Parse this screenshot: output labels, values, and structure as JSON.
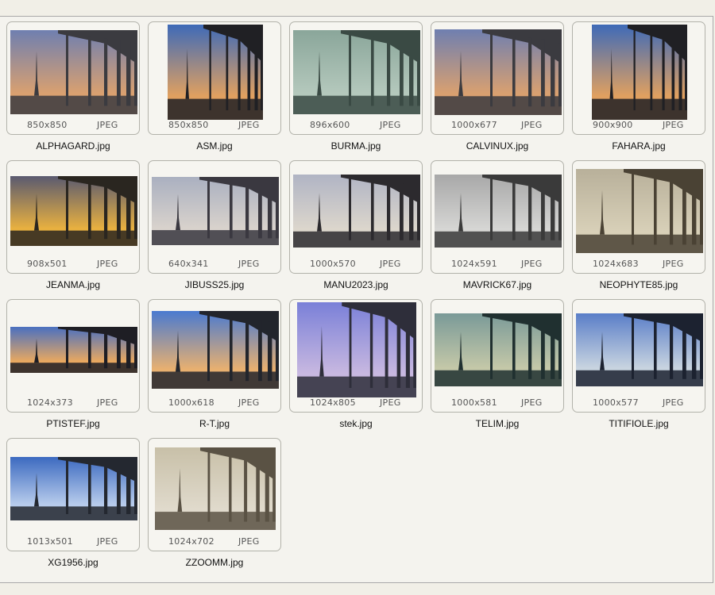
{
  "files": [
    {
      "name": "ALPHAGARD.jpg",
      "dims": "850x850",
      "type": "JPEG",
      "tone": "dusk"
    },
    {
      "name": "ASM.jpg",
      "dims": "850x850",
      "type": "JPEG",
      "tone": "blue-black"
    },
    {
      "name": "BURMA.jpg",
      "dims": "896x600",
      "type": "JPEG",
      "tone": "green"
    },
    {
      "name": "CALVINUX.jpg",
      "dims": "1000x677",
      "type": "JPEG",
      "tone": "dusk"
    },
    {
      "name": "FAHARA.jpg",
      "dims": "900x900",
      "type": "JPEG",
      "tone": "blue-black"
    },
    {
      "name": "JEANMA.jpg",
      "dims": "908x501",
      "type": "JPEG",
      "tone": "golden"
    },
    {
      "name": "JIBUSS25.jpg",
      "dims": "640x341",
      "type": "JPEG",
      "tone": "pale"
    },
    {
      "name": "MANU2023.jpg",
      "dims": "1000x570",
      "type": "JPEG",
      "tone": "pale-white"
    },
    {
      "name": "MAVRICK67.jpg",
      "dims": "1024x591",
      "type": "JPEG",
      "tone": "gray"
    },
    {
      "name": "NEOPHYTE85.jpg",
      "dims": "1024x683",
      "type": "JPEG",
      "tone": "sepia"
    },
    {
      "name": "PTISTEF.jpg",
      "dims": "1024x373",
      "type": "JPEG",
      "tone": "blue-sunset"
    },
    {
      "name": "R-T.jpg",
      "dims": "1000x618",
      "type": "JPEG",
      "tone": "blue-black-frame"
    },
    {
      "name": "stek.jpg",
      "dims": "1024x805",
      "type": "JPEG",
      "tone": "purple"
    },
    {
      "name": "TELIM.jpg",
      "dims": "1000x581",
      "type": "JPEG",
      "tone": "teal"
    },
    {
      "name": "TITIFIOLE.jpg",
      "dims": "1000x577",
      "type": "JPEG",
      "tone": "blue-night"
    },
    {
      "name": "XG1956.jpg",
      "dims": "1013x501",
      "type": "JPEG",
      "tone": "blue"
    },
    {
      "name": "ZZOOMM.jpg",
      "dims": "1024x702",
      "type": "JPEG",
      "tone": "sepia-light"
    }
  ],
  "tone_colors": {
    "dusk": [
      "#6f7fb0",
      "#d9a070",
      "#3b3b40"
    ],
    "blue-black": [
      "#3e6ab8",
      "#e0a060",
      "#202024"
    ],
    "green": [
      "#8aa69a",
      "#b4c8bc",
      "#3a4a44"
    ],
    "golden": [
      "#5a5a70",
      "#e8b040",
      "#2a2620"
    ],
    "pale": [
      "#aab0c0",
      "#d8d2cc",
      "#3a3840"
    ],
    "pale-white": [
      "#b0b4c4",
      "#dcd6cc",
      "#2c2a2e"
    ],
    "gray": [
      "#a8a8a8",
      "#d6d6d4",
      "#3a3a3a"
    ],
    "sepia": [
      "#b8b09a",
      "#d8d0b8",
      "#4a4234"
    ],
    "blue-sunset": [
      "#4a70c0",
      "#e8a860",
      "#1e1e24"
    ],
    "blue-black-frame": [
      "#4a7ad0",
      "#e8b070",
      "#22252c"
    ],
    "purple": [
      "#7a80d8",
      "#c8b8e0",
      "#2e2e3a"
    ],
    "teal": [
      "#7a9a98",
      "#c4c8a8",
      "#203030"
    ],
    "blue-night": [
      "#5a7ec8",
      "#c8d4e0",
      "#1c2230"
    ],
    "blue": [
      "#3c6ac0",
      "#b8ccec",
      "#242830"
    ],
    "sepia-light": [
      "#c8c0a8",
      "#e0dacc",
      "#5a5244"
    ]
  }
}
